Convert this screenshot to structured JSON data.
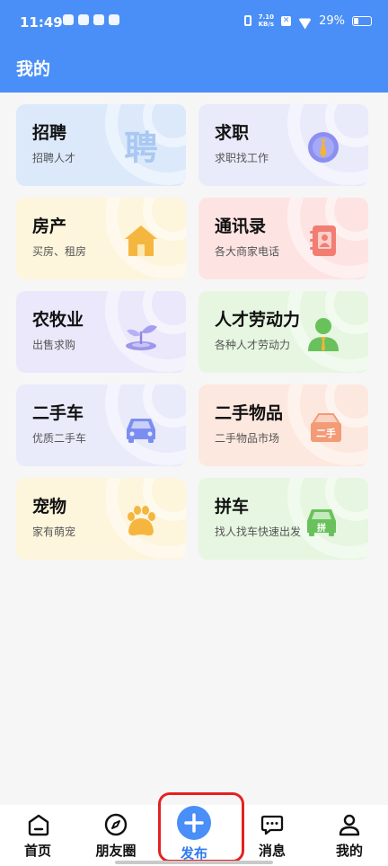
{
  "status_bar": {
    "time": "11:49",
    "net_speed_value": "7.10",
    "net_speed_unit": "KB/s",
    "battery": "29%"
  },
  "header": {
    "title": "我的"
  },
  "cards": [
    {
      "title": "招聘",
      "subtitle": "招聘人才",
      "icon": "recruit-icon",
      "icon_text": "聘",
      "color": "#dbe9fb"
    },
    {
      "title": "求职",
      "subtitle": "求职找工作",
      "icon": "job-seeker-icon",
      "color": "#e9ebfb"
    },
    {
      "title": "房产",
      "subtitle": "买房、租房",
      "icon": "house-icon",
      "color": "#fdf5dc"
    },
    {
      "title": "通讯录",
      "subtitle": "各大商家电话",
      "icon": "address-book-icon",
      "color": "#fde4e3"
    },
    {
      "title": "农牧业",
      "subtitle": "出售求购",
      "icon": "sprout-icon",
      "color": "#ebe8fb"
    },
    {
      "title": "人才劳动力",
      "subtitle": "各种人才劳动力",
      "icon": "worker-icon",
      "color": "#e6f6e1"
    },
    {
      "title": "二手车",
      "subtitle": "优质二手车",
      "icon": "car-icon",
      "color": "#e9ebfb"
    },
    {
      "title": "二手物品",
      "subtitle": "二手物品市场",
      "icon": "secondhand-box-icon",
      "icon_text": "二手",
      "color": "#fde8df"
    },
    {
      "title": "宠物",
      "subtitle": "家有萌宠",
      "icon": "paw-icon",
      "color": "#fdf5dc"
    },
    {
      "title": "拼车",
      "subtitle": "找人找车快速出发",
      "icon": "carpool-icon",
      "icon_text": "拼",
      "color": "#e6f6e1"
    }
  ],
  "nav": {
    "home": "首页",
    "moments": "朋友圈",
    "publish": "发布",
    "messages": "消息",
    "mine": "我的"
  },
  "colors": {
    "primary": "#4a8ff7",
    "publish_text": "#2f7af2",
    "highlight": "#e32222"
  }
}
